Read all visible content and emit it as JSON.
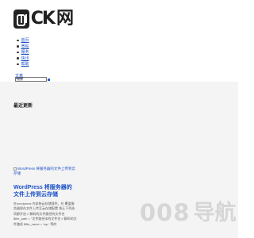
{
  "logo": {
    "text_ck": "CK",
    "text_net": "网"
  },
  "nav": {
    "items": [
      {
        "label": "首页"
      },
      {
        "label": "宽贴"
      },
      {
        "label": "服务"
      },
      {
        "label": "快讯"
      },
      {
        "label": "帮助"
      }
    ]
  },
  "stray_link": "文章",
  "search": {
    "value": "搜索"
  },
  "section": {
    "title": "最近更新"
  },
  "article": {
    "image_alt": "WordPress 将服务器的文件上传到云存储",
    "title": "WordPress 将服务器的文件上传到云存储",
    "excerpt": "在wordpress 内安装云存储插件。在 覆盖服务器保存文件上传至云存储配置 角让下列选项都开启 // 解码的文件路径的文件名 $file_path = \"文件路径本的文件名 // 解码的文件路径 $file_name = 'wp-' 等的"
  },
  "watermark": {
    "number": "008",
    "text": "导航"
  },
  "colors": {
    "link": "#1a4fc9",
    "band": "#f4f4f4",
    "watermark": "#d6d6d6"
  }
}
